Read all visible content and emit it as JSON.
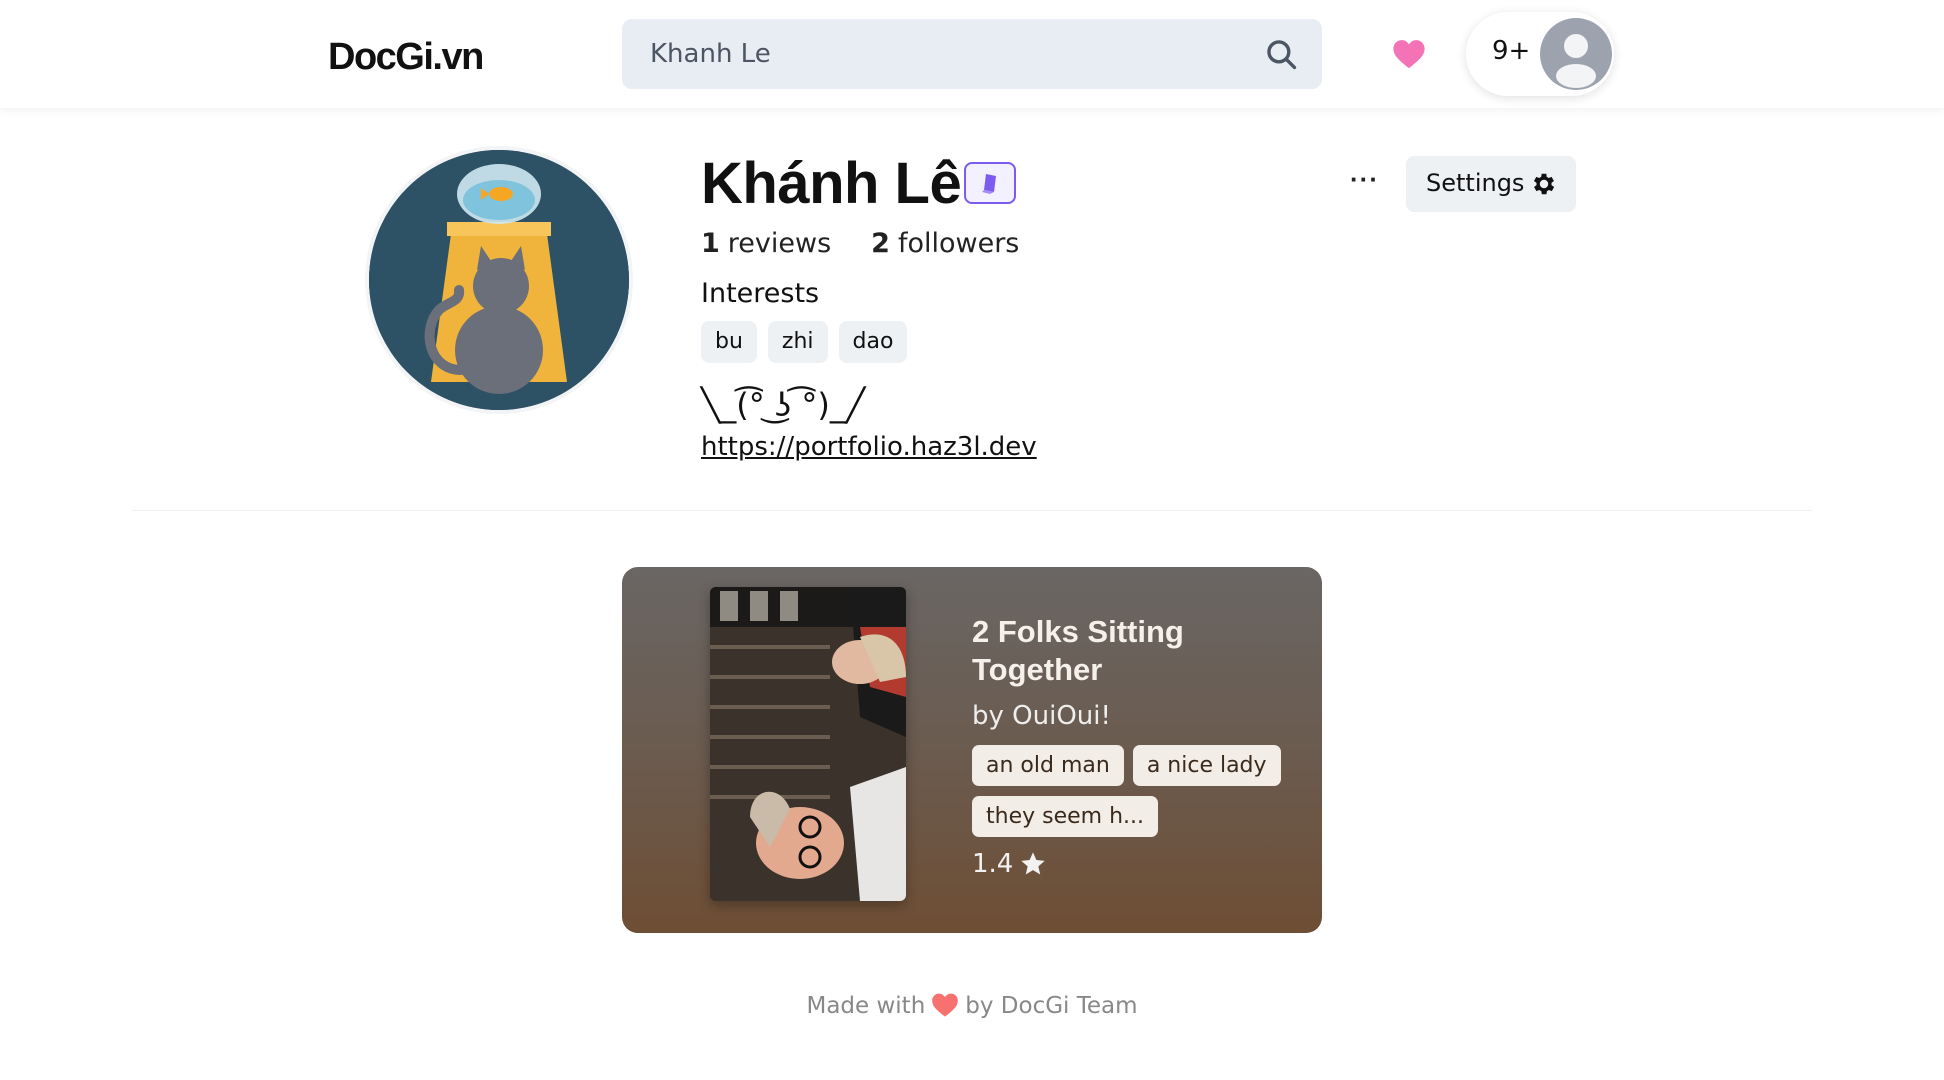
{
  "header": {
    "logo": "DocGi.vn",
    "search_value": "Khanh Le",
    "notification_count": "9+"
  },
  "profile": {
    "name": "Khánh Lê",
    "reviews_count": "1",
    "reviews_label": "reviews",
    "followers_count": "2",
    "followers_label": "followers",
    "interests_title": "Interests",
    "interests": [
      "bu",
      "zhi",
      "dao"
    ],
    "bio": "╲_(͡° ͜ʖ ͡°)_╱",
    "link": "https://portfolio.haz3l.dev",
    "more_label": "···",
    "settings_label": "Settings"
  },
  "review_card": {
    "title": "2 Folks Sitting Together",
    "author": "by OuiOui!",
    "tags": [
      "an old man",
      "a nice lady",
      "they seem h..."
    ],
    "rating": "1.4"
  },
  "footer": {
    "made_with": "Made with",
    "by_team": "by DocGi Team"
  },
  "colors": {
    "heart": "#f472b6",
    "badge": "#7c5cf0",
    "search_bg": "#e8edf3",
    "card_top": "#6a6664",
    "card_bottom": "#6e4e34"
  },
  "icons": [
    "search-icon",
    "heart-icon",
    "user-avatar-icon",
    "verified-badge-icon",
    "gear-icon",
    "star-icon"
  ]
}
